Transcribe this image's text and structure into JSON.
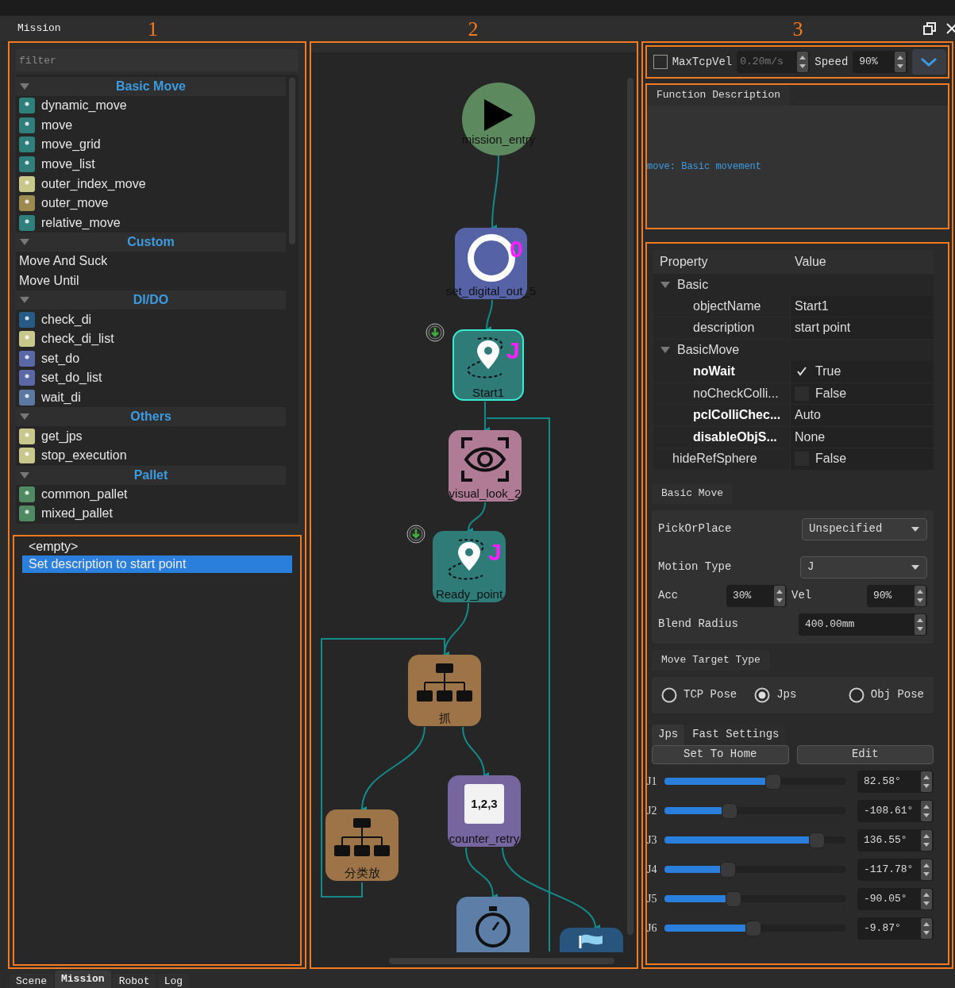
{
  "title_bar": {
    "title": "Mission"
  },
  "annotations": [
    {
      "label": "1"
    },
    {
      "label": "2"
    },
    {
      "label": "3"
    }
  ],
  "library": {
    "filter": {
      "placeholder": "filter"
    },
    "groups": [
      {
        "name": "Basic Move",
        "expanded": true,
        "items": [
          {
            "label": "dynamic_move",
            "color": "#2f7f7a"
          },
          {
            "label": "move",
            "color": "#2f7f7a"
          },
          {
            "label": "move_grid",
            "color": "#2f7f7a"
          },
          {
            "label": "move_list",
            "color": "#2f7f7a"
          },
          {
            "label": "outer_index_move",
            "color": "#c8c88c"
          },
          {
            "label": "outer_move",
            "color": "#9c8a50"
          },
          {
            "label": "relative_move",
            "color": "#2f7f7a"
          }
        ]
      },
      {
        "name": "Custom",
        "expanded": true,
        "items": [
          {
            "label": "Move And Suck"
          },
          {
            "label": "Move Until"
          }
        ]
      },
      {
        "name": "DI/DO",
        "expanded": true,
        "items": [
          {
            "label": "check_di",
            "color": "#285a86"
          },
          {
            "label": "check_di_list",
            "color": "#c8c88c"
          },
          {
            "label": "set_do",
            "color": "#5a68a8"
          },
          {
            "label": "set_do_list",
            "color": "#5a68a8"
          },
          {
            "label": "wait_di",
            "color": "#5a78a0"
          }
        ]
      },
      {
        "name": "Others",
        "expanded": true,
        "items": [
          {
            "label": "get_jps",
            "color": "#c8c88c"
          },
          {
            "label": "stop_execution",
            "color": "#c8c88c"
          }
        ]
      },
      {
        "name": "Pallet",
        "expanded": true,
        "items": [
          {
            "label": "common_pallet",
            "color": "#4f8a62"
          },
          {
            "label": "mixed_pallet",
            "color": "#4f8a62"
          }
        ]
      }
    ]
  },
  "history": {
    "items": [
      {
        "label": "<empty>",
        "selected": false
      },
      {
        "label": "Set description to start point",
        "selected": true
      }
    ]
  },
  "canvas": {
    "nodes": [
      {
        "label": "mission_entry",
        "kind": "entry",
        "selected": false
      },
      {
        "label": "set_digital_out_5",
        "kind": "digital_out",
        "badge": "0",
        "selected": false
      },
      {
        "label": "Start1",
        "kind": "move",
        "badge": "J",
        "selected": true
      },
      {
        "label": "visual_look_2",
        "kind": "vision",
        "selected": false
      },
      {
        "label": "Ready_point",
        "kind": "move",
        "badge": "J",
        "selected": false
      },
      {
        "label": "抓",
        "kind": "branch",
        "selected": false
      },
      {
        "label": "分类放",
        "kind": "branch",
        "selected": false
      },
      {
        "label": "counter_retry",
        "kind": "counter",
        "icon_text": "1,2,3",
        "selected": false
      },
      {
        "kind": "timer",
        "selected": false
      },
      {
        "kind": "flag",
        "selected": false
      }
    ]
  },
  "toolbar": {
    "max_tcp_vel": {
      "label": "MaxTcpVel",
      "checked": false,
      "value": "0.20m/s",
      "disabled": true
    },
    "speed": {
      "label": "Speed",
      "value": "90%"
    }
  },
  "function_description": {
    "title": "Function Description",
    "text": "move: Basic movement"
  },
  "properties": {
    "columns": [
      "Property",
      "Value"
    ],
    "groups": [
      {
        "name": "Basic",
        "expanded": true,
        "rows": [
          {
            "name": "objectName",
            "value": "Start1",
            "kind": "text",
            "modified": false
          },
          {
            "name": "description",
            "value": "start point",
            "kind": "text",
            "modified": false
          }
        ]
      },
      {
        "name": "BasicMove",
        "expanded": true,
        "rows": [
          {
            "name": "noWait",
            "value": "True",
            "kind": "checkbox",
            "checked": true,
            "modified": true
          },
          {
            "name": "noCheckColli...",
            "value": "False",
            "kind": "checkbox",
            "checked": false,
            "modified": false
          },
          {
            "name": "pclColliChec...",
            "value": "Auto",
            "kind": "text",
            "modified": true
          },
          {
            "name": "disableObjS...",
            "value": "None",
            "kind": "text",
            "modified": true
          }
        ]
      }
    ],
    "rows": [
      {
        "name": "hideRefSphere",
        "value": "False",
        "kind": "checkbox",
        "checked": false,
        "modified": false
      }
    ]
  },
  "basic_move": {
    "title": "Basic Move",
    "pick_or_place": {
      "label": "PickOrPlace",
      "value": "Unspecified"
    },
    "motion_type": {
      "label": "Motion Type",
      "value": "J"
    },
    "acc": {
      "label": "Acc",
      "value": "30%"
    },
    "vel": {
      "label": "Vel",
      "value": "90%"
    },
    "blend_radius": {
      "label": "Blend Radius",
      "value": "400.00mm"
    }
  },
  "move_target_type": {
    "title": "Move Target Type",
    "options": [
      {
        "label": "TCP Pose",
        "selected": false
      },
      {
        "label": "Jps",
        "selected": true
      },
      {
        "label": "Obj Pose",
        "selected": false
      }
    ]
  },
  "joint_tabs": [
    {
      "label": "Jps",
      "selected": true
    },
    {
      "label": "Fast Settings",
      "selected": false
    }
  ],
  "buttons": [
    "Set To Home",
    "Edit"
  ],
  "joints": [
    {
      "label": "J1",
      "level": 0.6,
      "value": "82.58°"
    },
    {
      "label": "J2",
      "level": 0.36,
      "value": "-108.61°"
    },
    {
      "label": "J3",
      "level": 0.84,
      "value": "136.55°"
    },
    {
      "label": "J4",
      "level": 0.35,
      "value": "-117.78°"
    },
    {
      "label": "J5",
      "level": 0.38,
      "value": "-90.05°"
    },
    {
      "label": "J6",
      "level": 0.49,
      "value": "-9.87°"
    }
  ],
  "bottom_tabs": [
    {
      "label": "Scene",
      "selected": false
    },
    {
      "label": "Mission",
      "selected": true
    },
    {
      "label": "Robot",
      "selected": false
    },
    {
      "label": "Log",
      "selected": false
    }
  ]
}
